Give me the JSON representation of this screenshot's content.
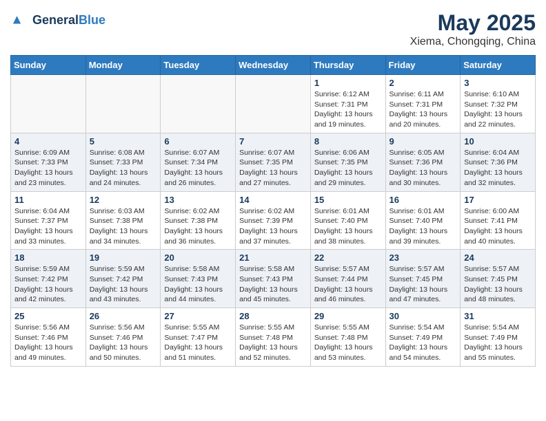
{
  "header": {
    "logo_general": "General",
    "logo_blue": "Blue",
    "month": "May 2025",
    "location": "Xiema, Chongqing, China"
  },
  "weekdays": [
    "Sunday",
    "Monday",
    "Tuesday",
    "Wednesday",
    "Thursday",
    "Friday",
    "Saturday"
  ],
  "weeks": [
    [
      {
        "day": "",
        "info": ""
      },
      {
        "day": "",
        "info": ""
      },
      {
        "day": "",
        "info": ""
      },
      {
        "day": "",
        "info": ""
      },
      {
        "day": "1",
        "info": "Sunrise: 6:12 AM\nSunset: 7:31 PM\nDaylight: 13 hours\nand 19 minutes."
      },
      {
        "day": "2",
        "info": "Sunrise: 6:11 AM\nSunset: 7:31 PM\nDaylight: 13 hours\nand 20 minutes."
      },
      {
        "day": "3",
        "info": "Sunrise: 6:10 AM\nSunset: 7:32 PM\nDaylight: 13 hours\nand 22 minutes."
      }
    ],
    [
      {
        "day": "4",
        "info": "Sunrise: 6:09 AM\nSunset: 7:33 PM\nDaylight: 13 hours\nand 23 minutes."
      },
      {
        "day": "5",
        "info": "Sunrise: 6:08 AM\nSunset: 7:33 PM\nDaylight: 13 hours\nand 24 minutes."
      },
      {
        "day": "6",
        "info": "Sunrise: 6:07 AM\nSunset: 7:34 PM\nDaylight: 13 hours\nand 26 minutes."
      },
      {
        "day": "7",
        "info": "Sunrise: 6:07 AM\nSunset: 7:35 PM\nDaylight: 13 hours\nand 27 minutes."
      },
      {
        "day": "8",
        "info": "Sunrise: 6:06 AM\nSunset: 7:35 PM\nDaylight: 13 hours\nand 29 minutes."
      },
      {
        "day": "9",
        "info": "Sunrise: 6:05 AM\nSunset: 7:36 PM\nDaylight: 13 hours\nand 30 minutes."
      },
      {
        "day": "10",
        "info": "Sunrise: 6:04 AM\nSunset: 7:36 PM\nDaylight: 13 hours\nand 32 minutes."
      }
    ],
    [
      {
        "day": "11",
        "info": "Sunrise: 6:04 AM\nSunset: 7:37 PM\nDaylight: 13 hours\nand 33 minutes."
      },
      {
        "day": "12",
        "info": "Sunrise: 6:03 AM\nSunset: 7:38 PM\nDaylight: 13 hours\nand 34 minutes."
      },
      {
        "day": "13",
        "info": "Sunrise: 6:02 AM\nSunset: 7:38 PM\nDaylight: 13 hours\nand 36 minutes."
      },
      {
        "day": "14",
        "info": "Sunrise: 6:02 AM\nSunset: 7:39 PM\nDaylight: 13 hours\nand 37 minutes."
      },
      {
        "day": "15",
        "info": "Sunrise: 6:01 AM\nSunset: 7:40 PM\nDaylight: 13 hours\nand 38 minutes."
      },
      {
        "day": "16",
        "info": "Sunrise: 6:01 AM\nSunset: 7:40 PM\nDaylight: 13 hours\nand 39 minutes."
      },
      {
        "day": "17",
        "info": "Sunrise: 6:00 AM\nSunset: 7:41 PM\nDaylight: 13 hours\nand 40 minutes."
      }
    ],
    [
      {
        "day": "18",
        "info": "Sunrise: 5:59 AM\nSunset: 7:42 PM\nDaylight: 13 hours\nand 42 minutes."
      },
      {
        "day": "19",
        "info": "Sunrise: 5:59 AM\nSunset: 7:42 PM\nDaylight: 13 hours\nand 43 minutes."
      },
      {
        "day": "20",
        "info": "Sunrise: 5:58 AM\nSunset: 7:43 PM\nDaylight: 13 hours\nand 44 minutes."
      },
      {
        "day": "21",
        "info": "Sunrise: 5:58 AM\nSunset: 7:43 PM\nDaylight: 13 hours\nand 45 minutes."
      },
      {
        "day": "22",
        "info": "Sunrise: 5:57 AM\nSunset: 7:44 PM\nDaylight: 13 hours\nand 46 minutes."
      },
      {
        "day": "23",
        "info": "Sunrise: 5:57 AM\nSunset: 7:45 PM\nDaylight: 13 hours\nand 47 minutes."
      },
      {
        "day": "24",
        "info": "Sunrise: 5:57 AM\nSunset: 7:45 PM\nDaylight: 13 hours\nand 48 minutes."
      }
    ],
    [
      {
        "day": "25",
        "info": "Sunrise: 5:56 AM\nSunset: 7:46 PM\nDaylight: 13 hours\nand 49 minutes."
      },
      {
        "day": "26",
        "info": "Sunrise: 5:56 AM\nSunset: 7:46 PM\nDaylight: 13 hours\nand 50 minutes."
      },
      {
        "day": "27",
        "info": "Sunrise: 5:55 AM\nSunset: 7:47 PM\nDaylight: 13 hours\nand 51 minutes."
      },
      {
        "day": "28",
        "info": "Sunrise: 5:55 AM\nSunset: 7:48 PM\nDaylight: 13 hours\nand 52 minutes."
      },
      {
        "day": "29",
        "info": "Sunrise: 5:55 AM\nSunset: 7:48 PM\nDaylight: 13 hours\nand 53 minutes."
      },
      {
        "day": "30",
        "info": "Sunrise: 5:54 AM\nSunset: 7:49 PM\nDaylight: 13 hours\nand 54 minutes."
      },
      {
        "day": "31",
        "info": "Sunrise: 5:54 AM\nSunset: 7:49 PM\nDaylight: 13 hours\nand 55 minutes."
      }
    ]
  ]
}
